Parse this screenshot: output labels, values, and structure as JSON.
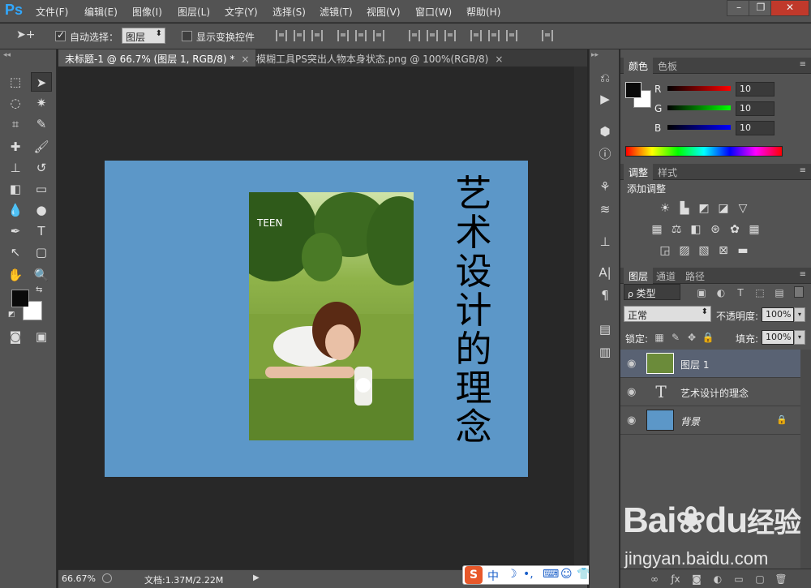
{
  "app": {
    "logo": "Ps"
  },
  "menu": [
    "文件(F)",
    "编辑(E)",
    "图像(I)",
    "图层(L)",
    "文字(Y)",
    "选择(S)",
    "滤镜(T)",
    "视图(V)",
    "窗口(W)",
    "帮助(H)"
  ],
  "window_controls": {
    "minimize": "–",
    "restore": "❐",
    "close": "✕"
  },
  "options": {
    "auto_select_label": "自动选择：",
    "auto_select_checked": true,
    "auto_select_value": "图层",
    "show_transform_label": "显示变换控件",
    "show_transform_checked": false
  },
  "tabs": [
    {
      "label": "未标题-1 @ 66.7% (图层 1, RGB/8) *",
      "active": true
    },
    {
      "label": "模糊工具PS突出人物本身状态.png @ 100%(RGB/8)",
      "active": false
    }
  ],
  "canvas": {
    "background_color": "#5c97c8",
    "vertical_text": "艺术设计的理念",
    "photo_watermark": "TEEN"
  },
  "status": {
    "zoom": "66.67%",
    "doc": "文档:1.37M/2.22M"
  },
  "color_panel": {
    "tabs": [
      "颜色",
      "色板"
    ],
    "r_label": "R",
    "g_label": "G",
    "b_label": "B",
    "r": "10",
    "g": "10",
    "b": "10",
    "foreground": "#0a0a0a",
    "background": "#ffffff"
  },
  "adjust_panel": {
    "tabs": [
      "调整",
      "样式"
    ],
    "title": "添加调整"
  },
  "layers_panel": {
    "tabs": [
      "图层",
      "通道",
      "路径"
    ],
    "filter": "类型",
    "blend_mode": "正常",
    "opacity_label": "不透明度:",
    "opacity": "100%",
    "lock_label": "锁定:",
    "fill_label": "填充:",
    "fill": "100%",
    "layers": [
      {
        "name": "图层 1",
        "type": "image",
        "selected": true
      },
      {
        "name": "艺术设计的理念",
        "type": "text",
        "selected": false
      },
      {
        "name": "背景",
        "type": "fill",
        "selected": false,
        "locked": true
      }
    ]
  },
  "watermark": {
    "logo": "Bai",
    "logo2": "du",
    "logo3": "经验",
    "url": "jingyan.baidu.com"
  },
  "ime": {
    "label": "中"
  }
}
